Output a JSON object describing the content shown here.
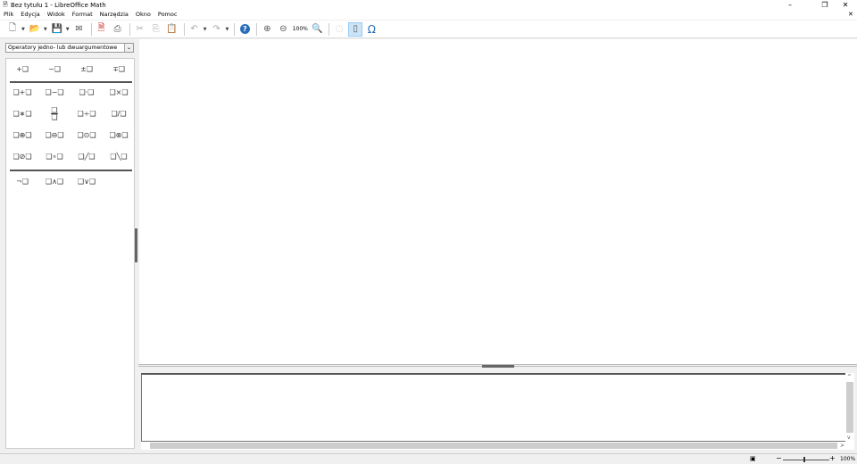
{
  "window": {
    "title": "Bez tytułu 1 - LibreOffice Math",
    "minimize": "–",
    "restore": "❐",
    "close": "✕",
    "doc_close": "✕"
  },
  "menu": [
    "Plik",
    "Edycja",
    "Widok",
    "Format",
    "Narzędzia",
    "Okno",
    "Pomoc"
  ],
  "toolbar": {
    "zoom_label": "100%"
  },
  "panel": {
    "category": "Operatory jedno- lub dwuargumentowe",
    "rows": [
      [
        "+❑",
        "−❑",
        "±❑",
        "∓❑"
      ],
      [
        "❑+❑",
        "❑−❑",
        "❑·❑",
        "❑×❑"
      ],
      [
        "❑∗❑",
        "❑/❑ (frac)",
        "❑÷❑",
        "❑/❑"
      ],
      [
        "❑⊕❑",
        "❑⊖❑",
        "❑⊙❑",
        "❑⊗❑"
      ],
      [
        "❑⊘❑",
        "❑∘❑",
        "❑╱❑",
        "❑╲❑"
      ],
      [
        "¬❑",
        "❑∧❑",
        "❑∨❑"
      ]
    ]
  },
  "editor": {
    "value": ""
  },
  "status": {
    "zoom": "100%",
    "zoom_minus": "−",
    "zoom_plus": "+"
  }
}
